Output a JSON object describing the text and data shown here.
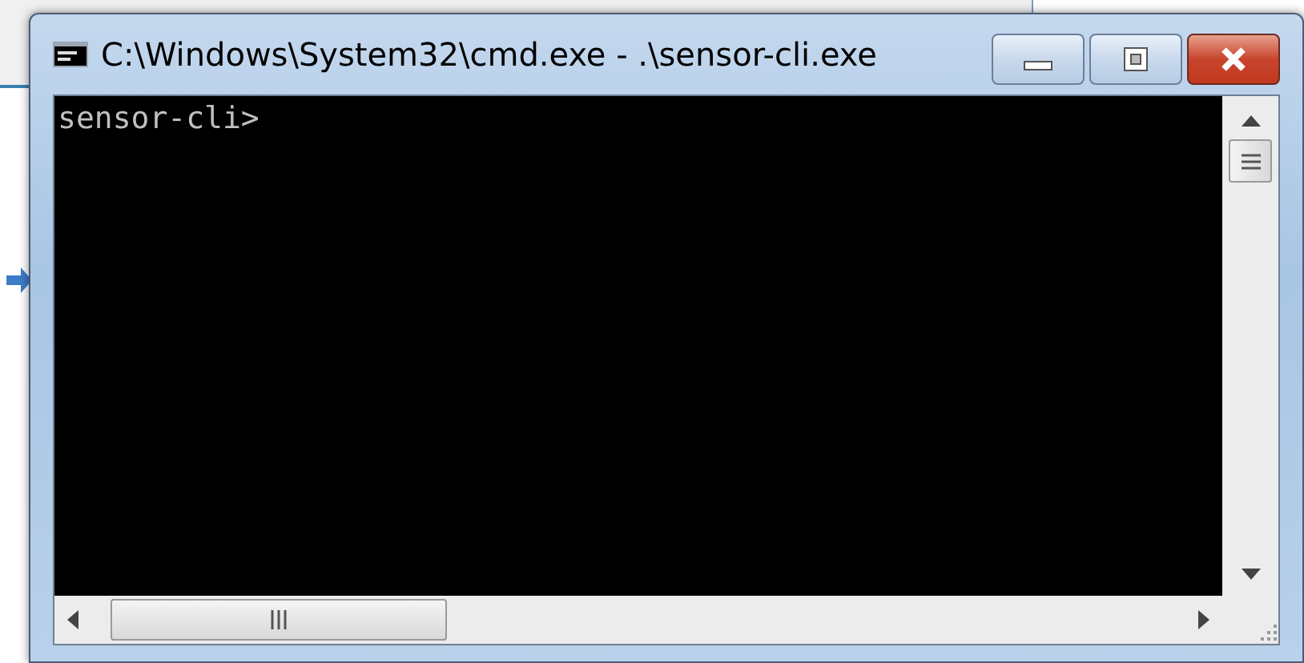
{
  "window": {
    "title": "C:\\Windows\\System32\\cmd.exe - .\\sensor-cli.exe"
  },
  "console": {
    "lines": [
      "sensor-cli>"
    ]
  }
}
